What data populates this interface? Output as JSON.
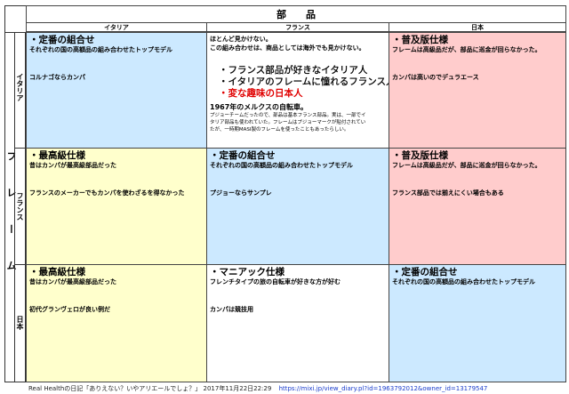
{
  "header": {
    "title": "部　　品",
    "columns": [
      "イタリア",
      "フランス",
      "日本"
    ]
  },
  "frame_label": "フレーム",
  "rows": [
    {
      "label": "イタリア",
      "cells": [
        {
          "heading": "・定番の組合せ",
          "sub": "それぞれの国の高額品の組み合わせたトップモデル",
          "note": "コルナゴならカンパ"
        },
        {
          "line1": "ほとんど見かけない。",
          "line2": "この組み合わせは、商品としては海外でも見かけない。",
          "bullets": [
            "・フランス部品が好きなイタリア人",
            "・イタリアのフレームに憧れるフランス人"
          ],
          "red_bullet": "・変な趣味の日本人",
          "story_title": "1967年のメルクスの自転車。",
          "story": [
            "プジョーチームだったので、部品は基本フランス部品。実は、一部でイ",
            "タリア部品も使われていた。フレームはプジョーマークが貼付されてい",
            "たが、一時期MASI製のフレームを使ったこともあったらしい。"
          ]
        },
        {
          "heading": "・普及版仕様",
          "sub": "フレームは高級品だが、部品に巡金が回らなかった。",
          "note": "カンパは高いのでデュラエース"
        }
      ]
    },
    {
      "label": "フランス",
      "cells": [
        {
          "heading": "・最高級仕様",
          "sub": "昔はカンパが最高級部品だった",
          "note": "フランスのメーカーでもカンパを使わざるを得なかった"
        },
        {
          "heading": "・定番の組合せ",
          "sub": "それぞれの国の高額品の組み合わせたトップモデル",
          "note": "プジョーならサンプレ"
        },
        {
          "heading": "・普及版仕様",
          "sub": "フレームは高級品だが、部品に巡金が回らなかった。",
          "note": "フランス部品では揃えにくい場合もある"
        }
      ]
    },
    {
      "label": "日本",
      "cells": [
        {
          "heading": "・最高級仕様",
          "sub": "昔はカンパが最高級部品だった",
          "note": "初代グランヴェロが良い例だ"
        },
        {
          "heading": "・マニアック仕様",
          "sub": "フレンチタイプの旅の自転車が好きな方が好む",
          "note": "カンパは競技用"
        },
        {
          "heading": "・定番の組合せ",
          "sub": "それぞれの国の高額品の組み合わせたトップモデル",
          "note": ""
        }
      ]
    }
  ],
  "footer": {
    "text": "Real Healthの日記「ありえない？いやアリエールでしょ？」 2017年11月22日22:29",
    "link": "https://mixi.jp/view_diary.pl?id=1963792012&owner_id=13179547"
  },
  "colors": {
    "blue": "#cce9ff",
    "yellow": "#ffffcc",
    "pink": "#ffcccc",
    "red": "#e00000"
  }
}
